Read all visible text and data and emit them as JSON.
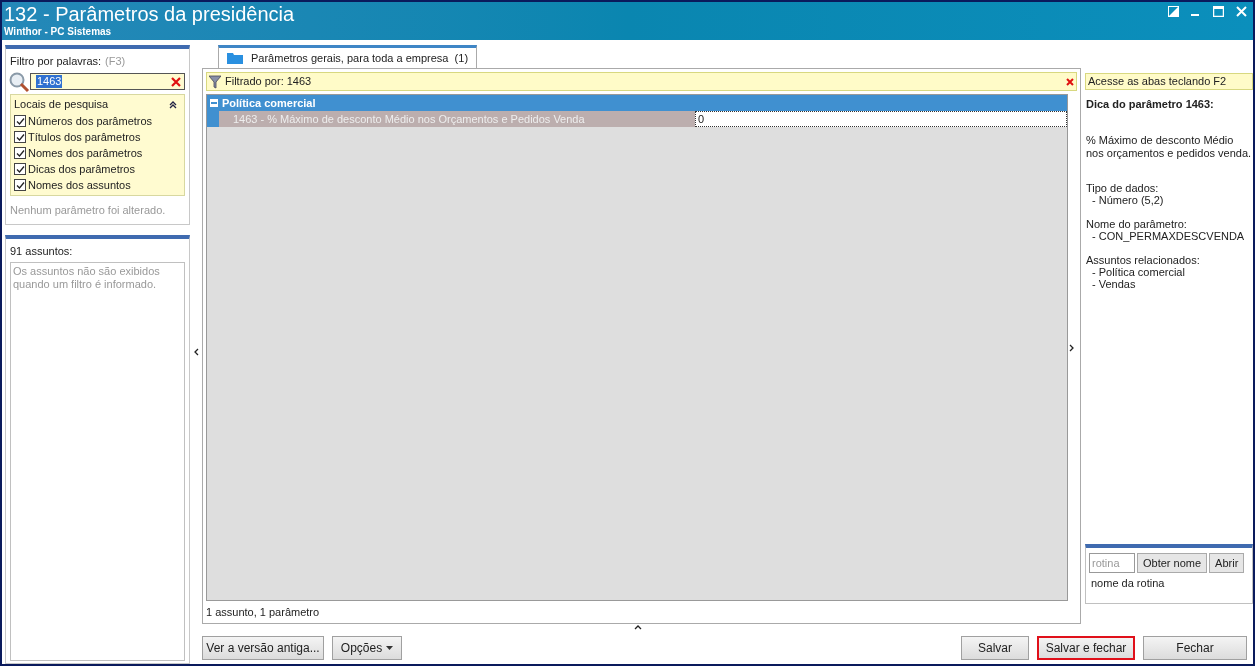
{
  "window": {
    "title": "132 - Parâmetros da presidência",
    "subtitle": "Winthor - PC Sistemas"
  },
  "filter": {
    "label": "Filtro por palavras:",
    "shortcut": "(F3)",
    "value": "1463"
  },
  "search_locations": {
    "title": "Locais de pesquisa",
    "expanded": true,
    "options": [
      {
        "label": "Números dos parâmetros",
        "checked": true
      },
      {
        "label": "Títulos dos parâmetros",
        "checked": true
      },
      {
        "label": "Nomes dos parâmetros",
        "checked": true
      },
      {
        "label": "Dicas dos parâmetros",
        "checked": true
      },
      {
        "label": "Nomes dos assuntos",
        "checked": true
      }
    ]
  },
  "change_status": "Nenhum parâmetro foi alterado.",
  "subjects": {
    "title": "91 assuntos:",
    "message": "Os assuntos não são exibidos quando um filtro é informado."
  },
  "tabs": [
    {
      "label": "Parâmetros gerais, para toda a empresa  (1)",
      "selected": true
    }
  ],
  "filter_bar": {
    "text": "Filtrado por: 1463"
  },
  "groups": [
    {
      "title": "Política comercial",
      "expanded": true,
      "rows": [
        {
          "label": "1463 - % Máximo de desconto Médio nos Orçamentos e Pedidos Venda",
          "value": "0",
          "selected": true
        }
      ]
    }
  ],
  "grid_status": "1 assunto, 1 parâmetro",
  "hint_panel": {
    "banner": "Acesse as abas teclando F2",
    "title": "Dica do parâmetro 1463:",
    "description": "% Máximo de desconto Médio nos orçamentos e pedidos venda.",
    "sections": [
      {
        "heading": "Tipo de dados:",
        "items": [
          "- Número (5,2)"
        ]
      },
      {
        "heading": "Nome do parâmetro:",
        "items": [
          "- CON_PERMAXDESCVENDA"
        ]
      },
      {
        "heading": "Assuntos relacionados:",
        "items": [
          "- Política comercial",
          "- Vendas"
        ]
      }
    ]
  },
  "routine": {
    "placeholder": "rotina",
    "buttons": [
      "Obter nome",
      "Abrir"
    ],
    "caption": "nome da rotina"
  },
  "footer_buttons": [
    {
      "label": "Ver a versão antiga...",
      "kind": "button",
      "highlighted": false
    },
    {
      "label": "Opções",
      "kind": "dropdown",
      "highlighted": false
    },
    {
      "label": "Salvar",
      "kind": "button",
      "highlighted": false
    },
    {
      "label": "Salvar e fechar",
      "kind": "button",
      "highlighted": true
    },
    {
      "label": "Fechar",
      "kind": "button",
      "highlighted": false
    }
  ]
}
